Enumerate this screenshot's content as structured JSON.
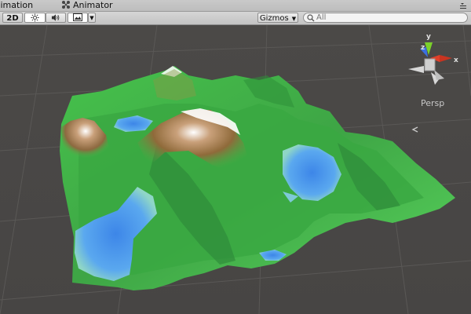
{
  "tabs": {
    "animation_label": "Animation",
    "animator_label": "Animator"
  },
  "toolbar": {
    "mode_2d_label": "2D",
    "gizmos_label": "Gizmos",
    "gizmos_icon": "chevron-down-icon",
    "search_placeholder": "All",
    "icons": [
      "sun-icon",
      "speaker-icon",
      "image-icon",
      "search-icon",
      "menu-icon"
    ]
  },
  "scene": {
    "projection_label": "Persp",
    "gizmo_axes": [
      "y",
      "z",
      "x"
    ],
    "axis_colors": {
      "x": "#e0402a",
      "y": "#7bd12a",
      "z": "#3b6fe0"
    }
  }
}
